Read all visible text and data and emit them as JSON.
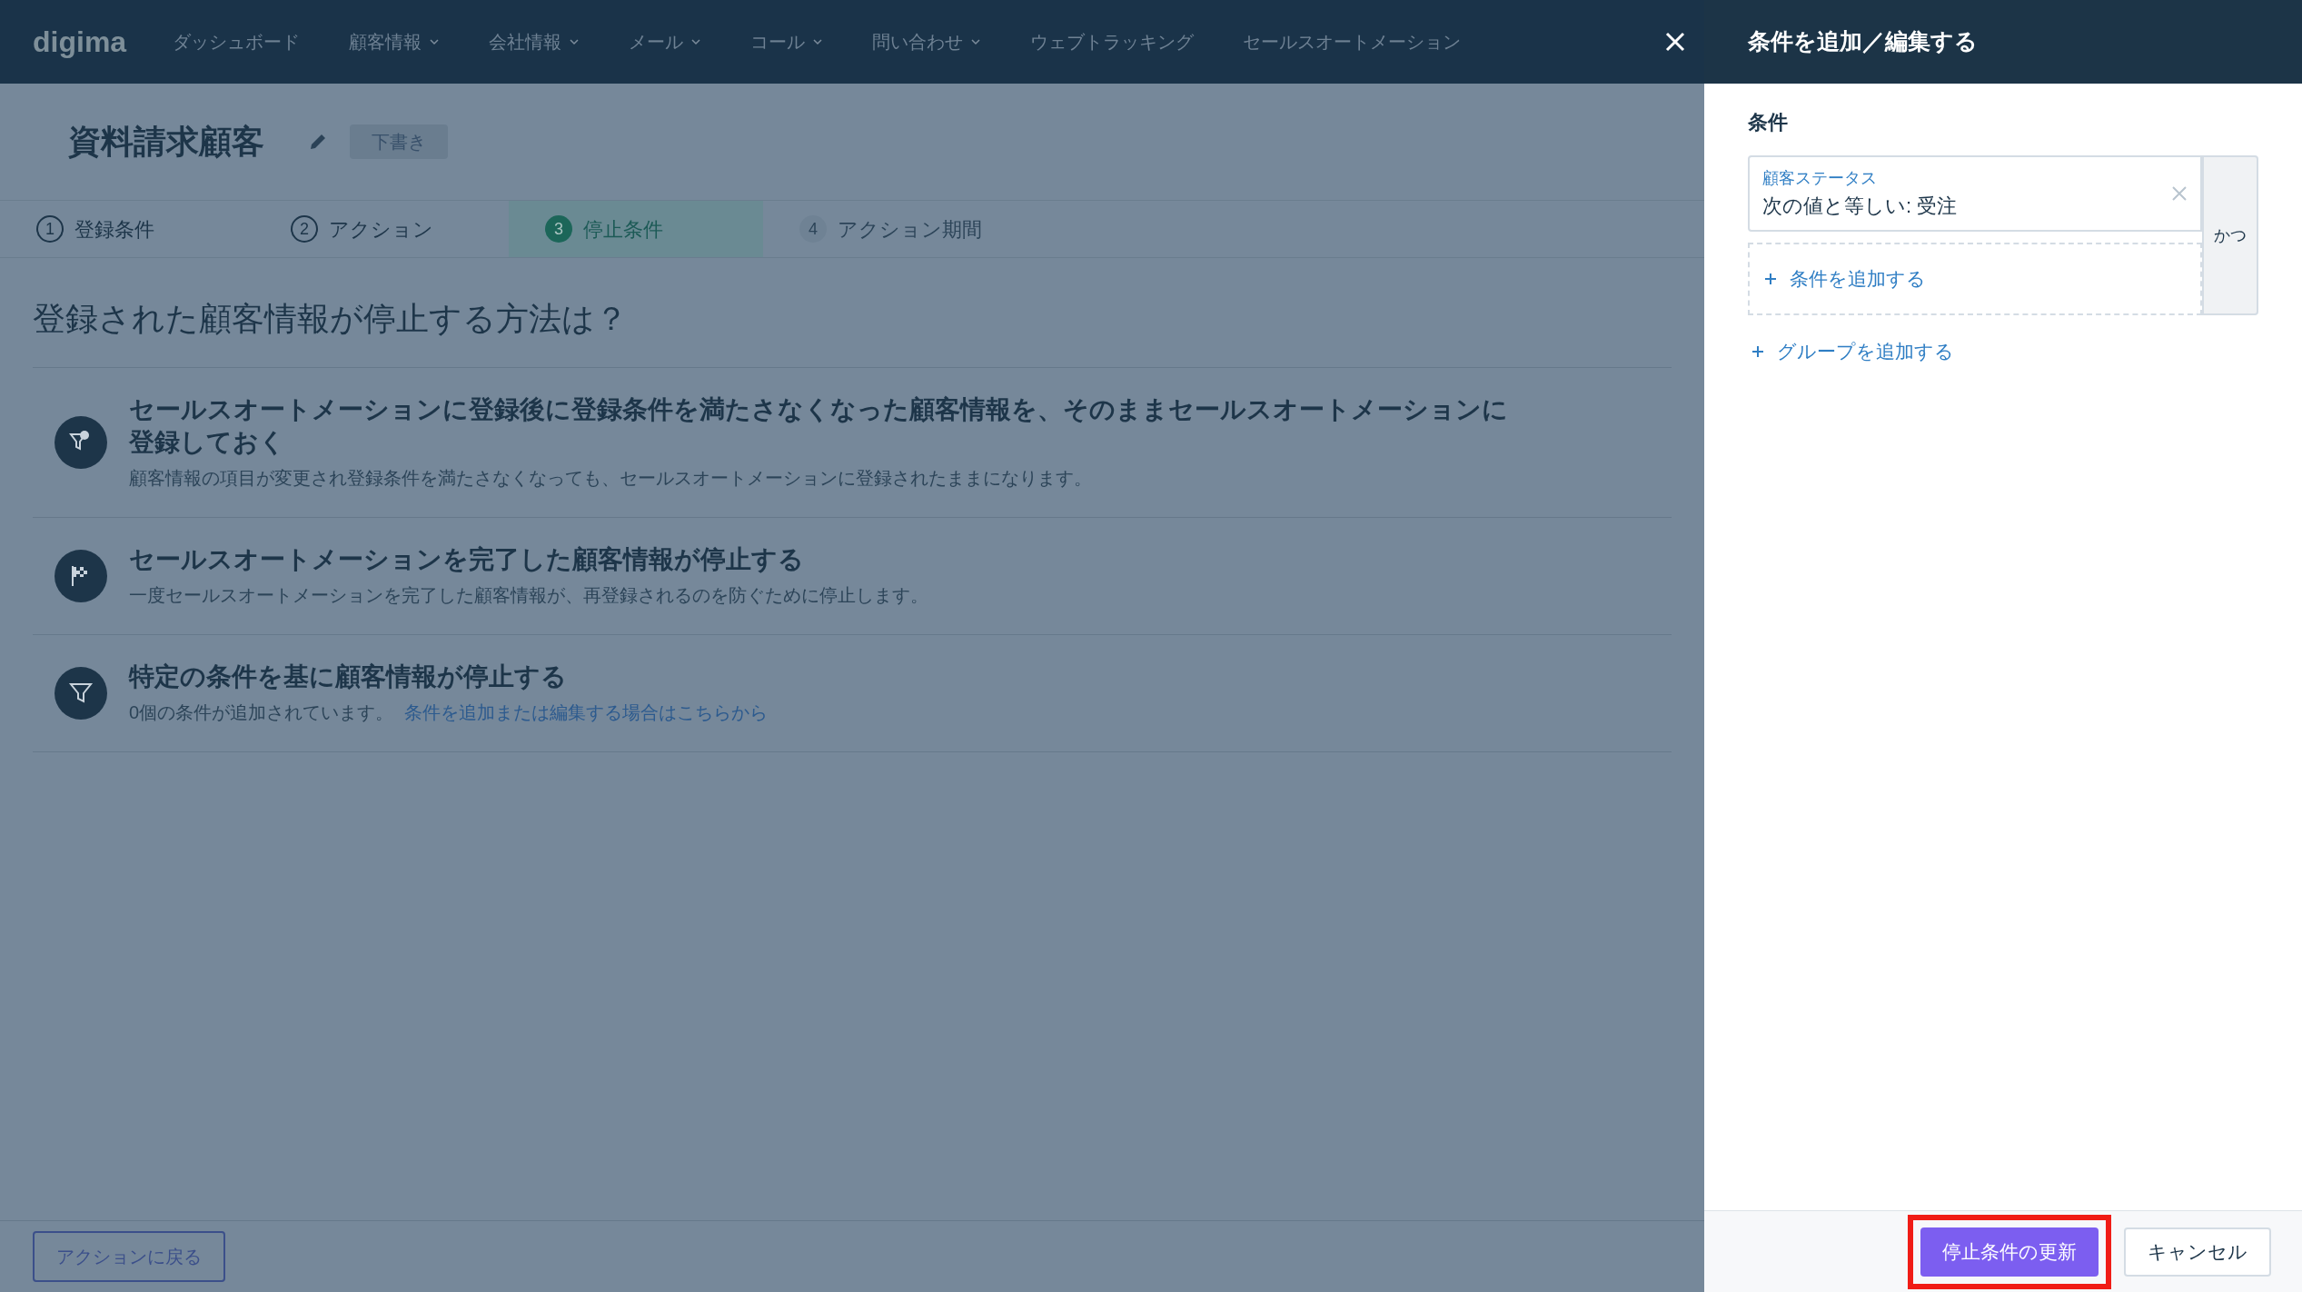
{
  "nav": {
    "logo": "digima",
    "items": [
      {
        "label": "ダッシュボード",
        "dropdown": false
      },
      {
        "label": "顧客情報",
        "dropdown": true
      },
      {
        "label": "会社情報",
        "dropdown": true
      },
      {
        "label": "メール",
        "dropdown": true
      },
      {
        "label": "コール",
        "dropdown": true
      },
      {
        "label": "問い合わせ",
        "dropdown": true
      },
      {
        "label": "ウェブトラッキング",
        "dropdown": false
      },
      {
        "label": "セールスオートメーション",
        "dropdown": false
      }
    ]
  },
  "page": {
    "title": "資料請求顧客",
    "status_badge": "下書き",
    "steps": [
      {
        "number": "1",
        "label": "登録条件",
        "selected": false,
        "done": true
      },
      {
        "number": "2",
        "label": "アクション",
        "selected": false,
        "done": true
      },
      {
        "number": "3",
        "label": "停止条件",
        "selected": true,
        "done": false
      },
      {
        "number": "4",
        "label": "アクション期間",
        "selected": false,
        "done": false
      }
    ],
    "question": "登録された顧客情報が停止する方法は？",
    "options": [
      {
        "kind": "funnel-badge",
        "title": "セールスオートメーションに登録後に登録条件を満たさなくなった顧客情報を、そのままセールスオートメーションに登録しておく",
        "description": "顧客情報の項目が変更され登録条件を満たさなくなっても、セールスオートメーションに登録されたままになります。"
      },
      {
        "kind": "flag",
        "title": "セールスオートメーションを完了した顧客情報が停止する",
        "description": "一度セールスオートメーションを完了した顧客情報が、再登録されるのを防ぐために停止します。"
      },
      {
        "kind": "funnel",
        "title": "特定の条件を基に顧客情報が停止する",
        "description": "0個の条件が追加されています。",
        "link": "条件を追加または編集する場合はこちらから"
      }
    ],
    "back_button": "アクションに戻る"
  },
  "panel": {
    "title": "条件を追加／編集する",
    "section_label": "条件",
    "conditions": [
      {
        "field": "顧客ステータス",
        "rule": "次の値と等しい: 受注"
      }
    ],
    "add_condition": "条件を追加する",
    "connector": "かつ",
    "add_group": "グループを追加する",
    "primary_button": "停止条件の更新",
    "primary_highlighted": true,
    "cancel_button": "キャンセル"
  }
}
